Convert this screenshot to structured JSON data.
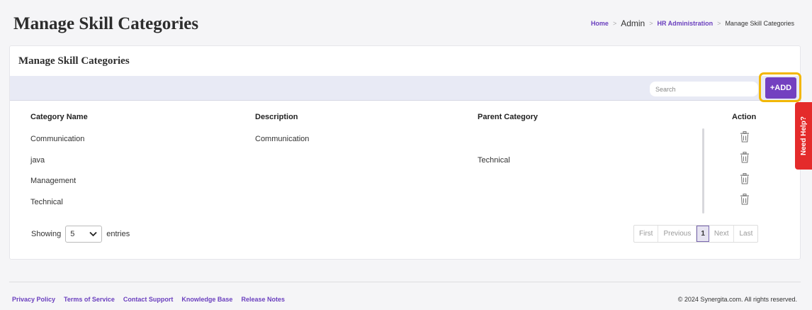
{
  "header": {
    "title": "Manage Skill Categories",
    "breadcrumb": [
      {
        "label": "Home"
      },
      {
        "label": "Admin"
      },
      {
        "label": "HR Administration"
      },
      {
        "label": "Manage Skill Categories"
      }
    ]
  },
  "card": {
    "title": "Manage Skill Categories",
    "search_placeholder": "Search",
    "add_label": "+ADD"
  },
  "table": {
    "columns": [
      "Category Name",
      "Description",
      "Parent Category",
      "Action"
    ],
    "rows": [
      {
        "name": "Communication",
        "description": "Communication",
        "parent": ""
      },
      {
        "name": "java",
        "description": "",
        "parent": "Technical"
      },
      {
        "name": "Management",
        "description": "",
        "parent": ""
      },
      {
        "name": "Technical",
        "description": "",
        "parent": ""
      }
    ]
  },
  "length": {
    "prefix": "Showing",
    "value": "5",
    "suffix": "entries"
  },
  "pagination": {
    "first": "First",
    "previous": "Previous",
    "current": "1",
    "next": "Next",
    "last": "Last"
  },
  "help_tab": "Need Help?",
  "footer": {
    "links": [
      "Privacy Policy",
      "Terms of Service",
      "Contact Support",
      "Knowledge Base",
      "Release Notes"
    ],
    "copyright": "© 2024 Synergita.com. All rights reserved."
  },
  "colors": {
    "accent": "#7340c0",
    "highlight": "#f2b705",
    "help": "#e42b2b"
  }
}
